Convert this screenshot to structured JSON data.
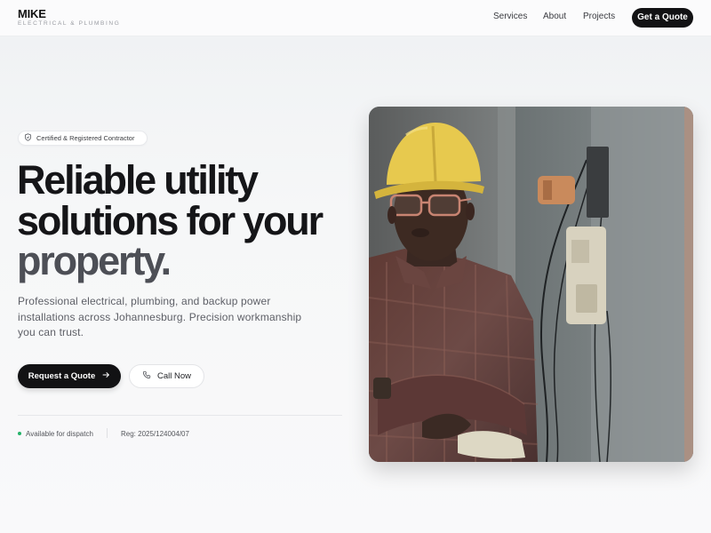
{
  "header": {
    "brand_name": "MIKE",
    "brand_sub": "ELECTRICAL & PLUMBING",
    "nav": [
      "Services",
      "About",
      "Projects"
    ],
    "cta_label": "Get a Quote"
  },
  "hero": {
    "badge_label": "Certified & Registered Contractor",
    "headline_line1": "Reliable utility",
    "headline_line2": "solutions for your",
    "headline_line3": "property.",
    "description": "Professional electrical, plumbing, and backup power installations across Johannesburg. Precision workmanship you can trust.",
    "primary_button": "Request a Quote",
    "secondary_button": "Call Now",
    "status": "Available for dispatch",
    "registration": "Reg: 2025/124004/07"
  },
  "icons": {
    "badge": "shield-check-icon",
    "primary_button": "arrow-right-icon",
    "secondary_button": "phone-icon"
  },
  "colors": {
    "primary": "#121214",
    "status": "#26b36a",
    "headline_muted": "#4d4f56"
  }
}
